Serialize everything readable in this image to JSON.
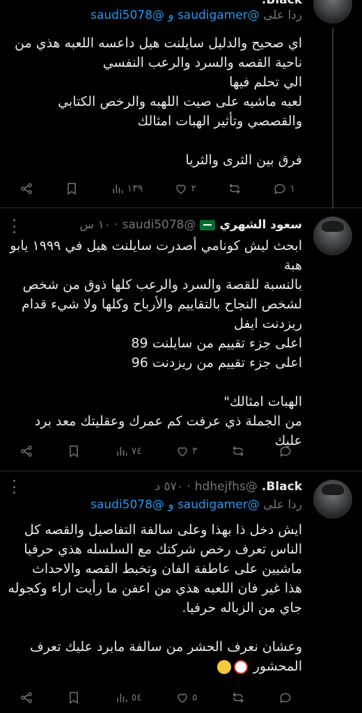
{
  "tweets": [
    {
      "replying_prefix": "ردا على",
      "mentions": "@saudigamer و @saudi5078",
      "top_name_fragment": "Black.",
      "body": "اي صحيح والدليل سايلنت هيل داعسه اللعبه هذي من\nناحية القصه والسرد والرعب النفسي\nالي تحلم فيها\nلعبه ماشيه على صيت اللهبه والرخص الكتابي\nوالقصصي وتأثير الهبات امثالك\n\nفرق بين الثرى والثريا",
      "stats": {
        "replies": "١",
        "reposts": "",
        "likes": "٢",
        "views": "١٣٩"
      }
    },
    {
      "name": "سعود الشهري",
      "handle": "@saudi5078",
      "time": "١٠ س",
      "body": "ابحث ليش كونامي أصدرت سايلنت هيل في ١٩٩٩ يابو\nهبة\nبالنسبة للقصة والسرد والرعب كلها ذوق من شخص\nلشخص النجاح بالتقاييم والأرباح وكلها ولا شيء قدام\nريزدنت ايفل\nاعلى جزء تقييم من سايلنت 89\nاعلى جزء تقييم من ريزدنت 96\n\nالهبات امثالك\"\nمن الجملة ذي عرفت كم عمرك وعقليتك معد برد عليك",
      "stats": {
        "replies": "",
        "reposts": "",
        "likes": "٣",
        "views": "٧٤"
      }
    },
    {
      "name": "Black.",
      "handle": "@hdhejfhs",
      "time": "٥٧٠ د",
      "replying_prefix": "ردا على",
      "mentions": "@saudigamer و @saudi5078",
      "body": "ايش دخل ذا بهذا وعلى سالفة التفاصيل والقصه كل\nالناس تعرف رخص شركتك مع السلسله هذي حرفيا\nماشيين على عاطفة الفان وتخبط القصه والاحداث\nهذا غير فان اللعبه هذي من اعفن ما رأيت اراء وكجوله\nجاي من الزباله حرفيا.\n\nوعشان نعرف الحشر من سالفة مابرد عليك تعرف\nالمحشور",
      "emojis": [
        "clown-face",
        "woozy-face"
      ],
      "stats": {
        "replies": "",
        "reposts": "",
        "likes": "٥",
        "views": "٥٤"
      }
    }
  ]
}
